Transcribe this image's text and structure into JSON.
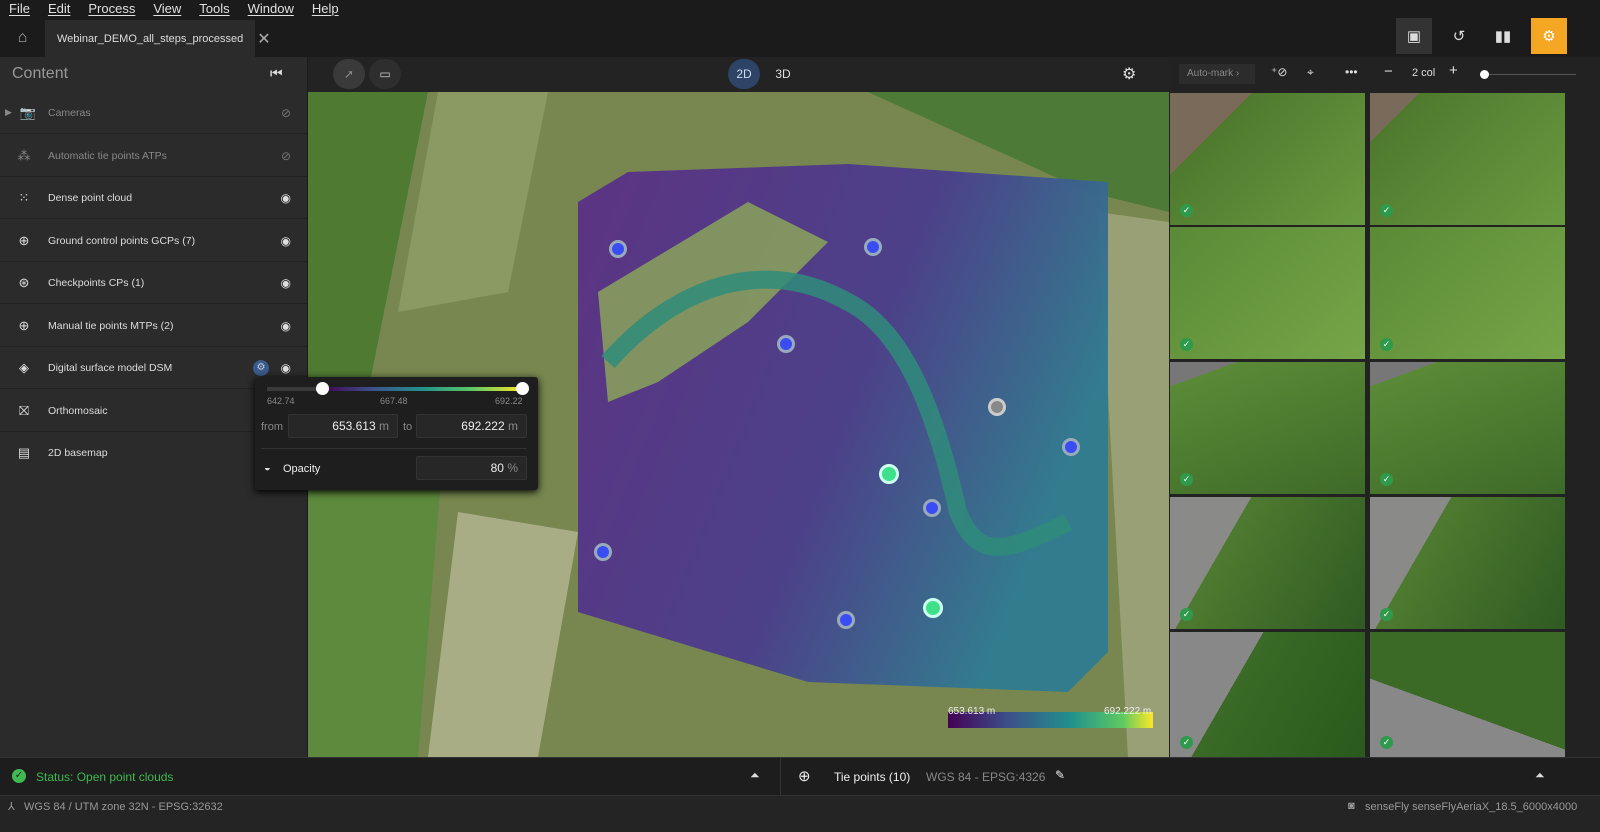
{
  "menu": [
    "File",
    "Edit",
    "Process",
    "View",
    "Tools",
    "Window",
    "Help"
  ],
  "tab": {
    "title": "Webinar_DEMO_all_steps_processed"
  },
  "sidebar": {
    "title": "Content",
    "layers": [
      {
        "label": "Cameras",
        "icon": "camera-icon",
        "visible": false
      },
      {
        "label": "Automatic tie points ATPs",
        "icon": "tie-points-icon",
        "visible": false
      },
      {
        "label": "Dense point cloud",
        "icon": "point-cloud-icon",
        "visible": true
      },
      {
        "label": "Ground control points GCPs (7)",
        "icon": "gcp-icon",
        "visible": true
      },
      {
        "label": "Checkpoints CPs (1)",
        "icon": "checkpoint-icon",
        "visible": true
      },
      {
        "label": "Manual tie points MTPs (2)",
        "icon": "mtp-icon",
        "visible": true
      },
      {
        "label": "Digital surface model DSM",
        "icon": "dsm-icon",
        "visible": true
      },
      {
        "label": "Orthomosaic",
        "icon": "orthomosaic-icon",
        "visible": true
      },
      {
        "label": "2D basemap",
        "icon": "basemap-icon",
        "visible": true
      }
    ]
  },
  "dsm_popup": {
    "range_min": "642.74",
    "range_mid": "667.48",
    "range_max": "692.22",
    "from_label": "from",
    "from_value": "653.613",
    "to_label": "to",
    "to_value": "692.222",
    "unit": "m",
    "opacity_label": "Opacity",
    "opacity_value": "80",
    "opacity_unit": "%"
  },
  "map_toolbar": {
    "mode_2d": "2D",
    "mode_3d": "3D",
    "active_mode": "2D"
  },
  "legend": {
    "min": "653.613 m",
    "max": "692.222 m"
  },
  "right_toolbar": {
    "automark": "Auto-mark",
    "columns": "2 col"
  },
  "status": {
    "text": "Status: Open point clouds",
    "tie_points": "Tie points (10)",
    "crs": "WGS 84 - EPSG:4326"
  },
  "footer": {
    "crs": "WGS 84 / UTM zone 32N - EPSG:32632",
    "camera": "senseFly senseFlyAeriaX_18.5_6000x4000"
  },
  "colors": {
    "accent": "#f5a623",
    "status_ok": "#3fb950",
    "gcp": "#3a4df5",
    "checkpoint": "#3ee08a"
  }
}
